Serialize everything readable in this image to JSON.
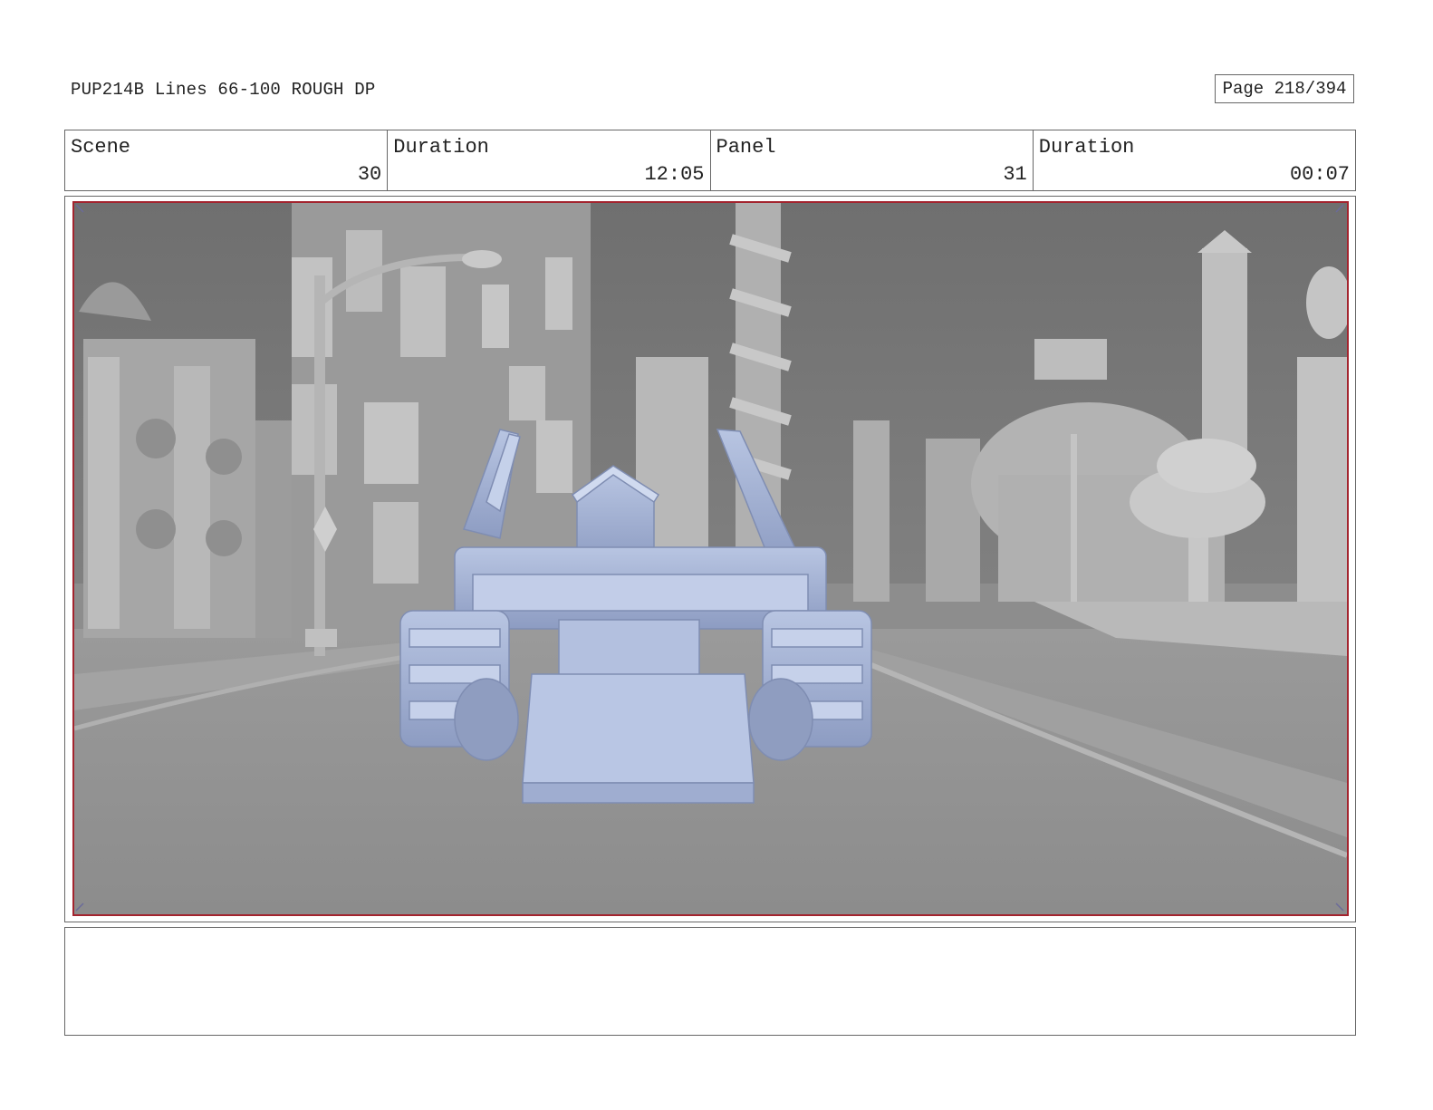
{
  "header": {
    "title": "PUP214B Lines 66-100 ROUGH DP",
    "page": "Page 218/394"
  },
  "info": [
    {
      "label": "Scene",
      "value": "30"
    },
    {
      "label": "Duration",
      "value": "12:05"
    },
    {
      "label": "Panel",
      "value": "31"
    },
    {
      "label": "Duration",
      "value": "00:07"
    }
  ],
  "panel": {
    "image": "storyboard-frame-street-with-bulldozer-vehicle",
    "border_color": "#a3242e",
    "vehicle_color": "#a7b5d6",
    "scene_color": "#a9a9a9"
  },
  "notes": ""
}
